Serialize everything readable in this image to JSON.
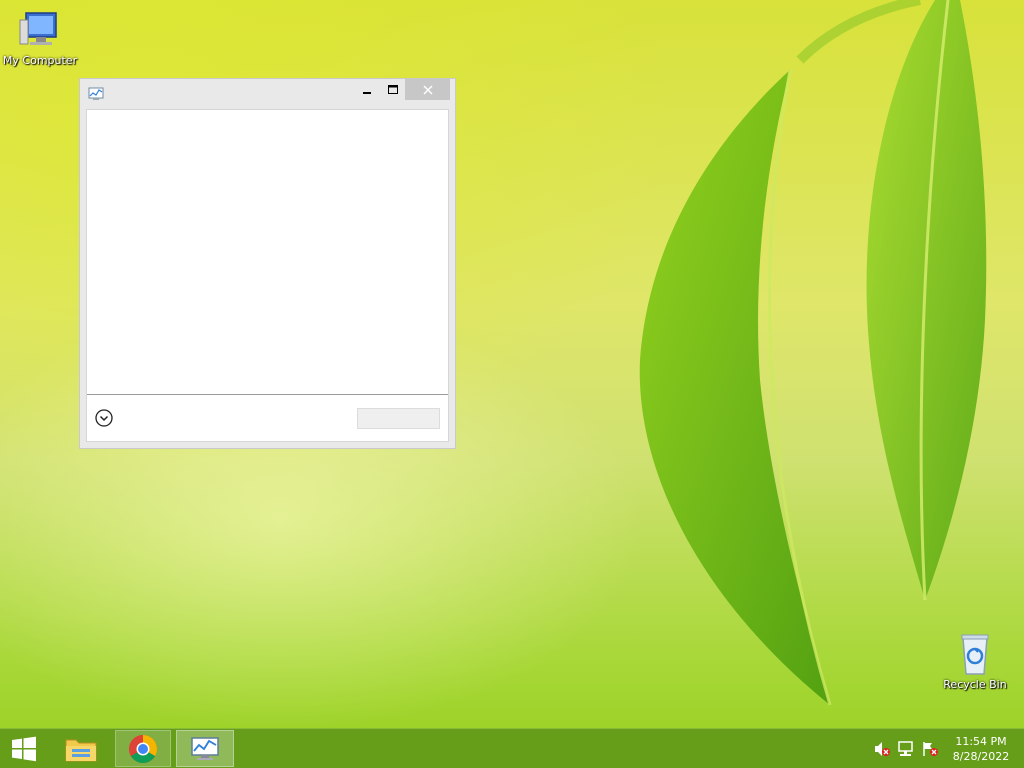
{
  "desktop": {
    "icons": [
      {
        "label": "My Computer"
      },
      {
        "label": "Recycle Bin"
      }
    ]
  },
  "window": {
    "title": "",
    "action_button_label": ""
  },
  "taskbar": {
    "apps": [
      "File Explorer",
      "Google Chrome",
      "Resource Monitor"
    ]
  },
  "tray": {
    "time": "11:54 PM",
    "date": "8/28/2022",
    "icons": [
      "volume-muted-icon",
      "network-icon",
      "action-center-flag-icon"
    ]
  },
  "colors": {
    "taskbar": "#5f9619",
    "close_button": "#c7c7c7",
    "window_frame": "#e9e9e9"
  }
}
